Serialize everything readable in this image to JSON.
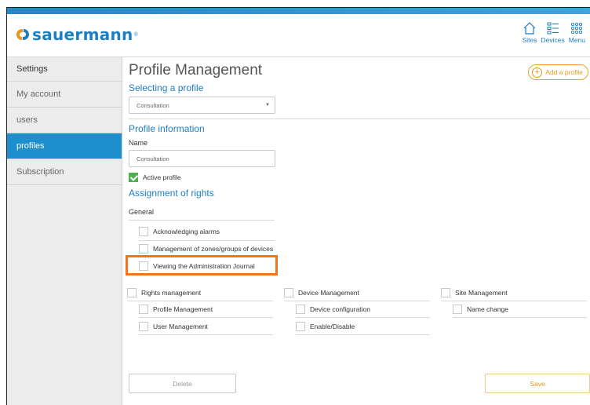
{
  "header": {
    "logo_text": "sauermann",
    "logo_reg": "®",
    "nav": {
      "sites_label": "Sites",
      "devices_label": "Devices",
      "menu_label": "Menu"
    }
  },
  "sidebar": {
    "title": "Settings",
    "items": [
      {
        "label": "My account",
        "active": false
      },
      {
        "label": "users",
        "active": false
      },
      {
        "label": "profiles",
        "active": true
      },
      {
        "label": "Subscription",
        "active": false
      }
    ]
  },
  "main": {
    "page_title": "Profile Management",
    "add_profile_label": "Add a profile",
    "selecting_title": "Selecting a profile",
    "profile_select_value": "Consultation",
    "profile_info_title": "Profile information",
    "name_label": "Name",
    "name_value": "Consultation",
    "active_profile_label": "Active profile",
    "assignment_title": "Assignment of rights",
    "general_label": "General",
    "general_rights": [
      "Acknowledging alarms",
      "Management of zones/groups of devices",
      "Viewing the Administration Journal"
    ],
    "rights_management": {
      "label": "Rights management",
      "items": [
        "Profile Management",
        "User Management"
      ]
    },
    "device_management": {
      "label": "Device Management",
      "items": [
        "Device configuration",
        "Enable/Disable"
      ]
    },
    "site_management": {
      "label": "Site Management",
      "items": [
        "Name change"
      ]
    },
    "delete_label": "Delete",
    "save_label": "Save"
  },
  "colors": {
    "accent_blue": "#1d7ec2",
    "active_bg": "#1d8fcd",
    "orange": "#e8951c",
    "highlight": "#f2731f",
    "check_green": "#4caf50"
  }
}
